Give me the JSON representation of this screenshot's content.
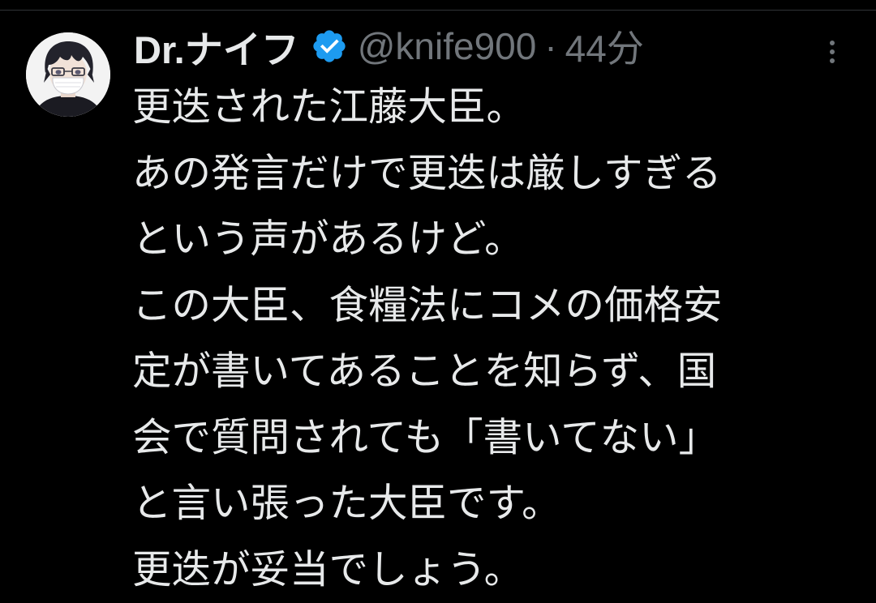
{
  "tweet": {
    "author": {
      "display_name": "Dr.ナイフ",
      "handle": "@knife900",
      "verified": true
    },
    "separator": "·",
    "timestamp": "44分",
    "text_lines": [
      "更迭された江藤大臣。",
      "あの発言だけで更迭は厳しすぎる",
      "という声があるけど。",
      "この大臣、食糧法にコメの価格安",
      "定が書いてあることを知らず、国",
      "会で質問されても「書いてない」",
      "と言い張った大臣です。",
      "更迭が妥当でしょう。"
    ]
  },
  "icons": {
    "verified": "verified-badge-icon",
    "more": "more-options-icon"
  },
  "colors": {
    "background": "#000000",
    "primary_text": "#e7e9ea",
    "secondary_text": "#71767b",
    "verified_blue": "#1d9bf0",
    "divider": "#2f3336"
  }
}
